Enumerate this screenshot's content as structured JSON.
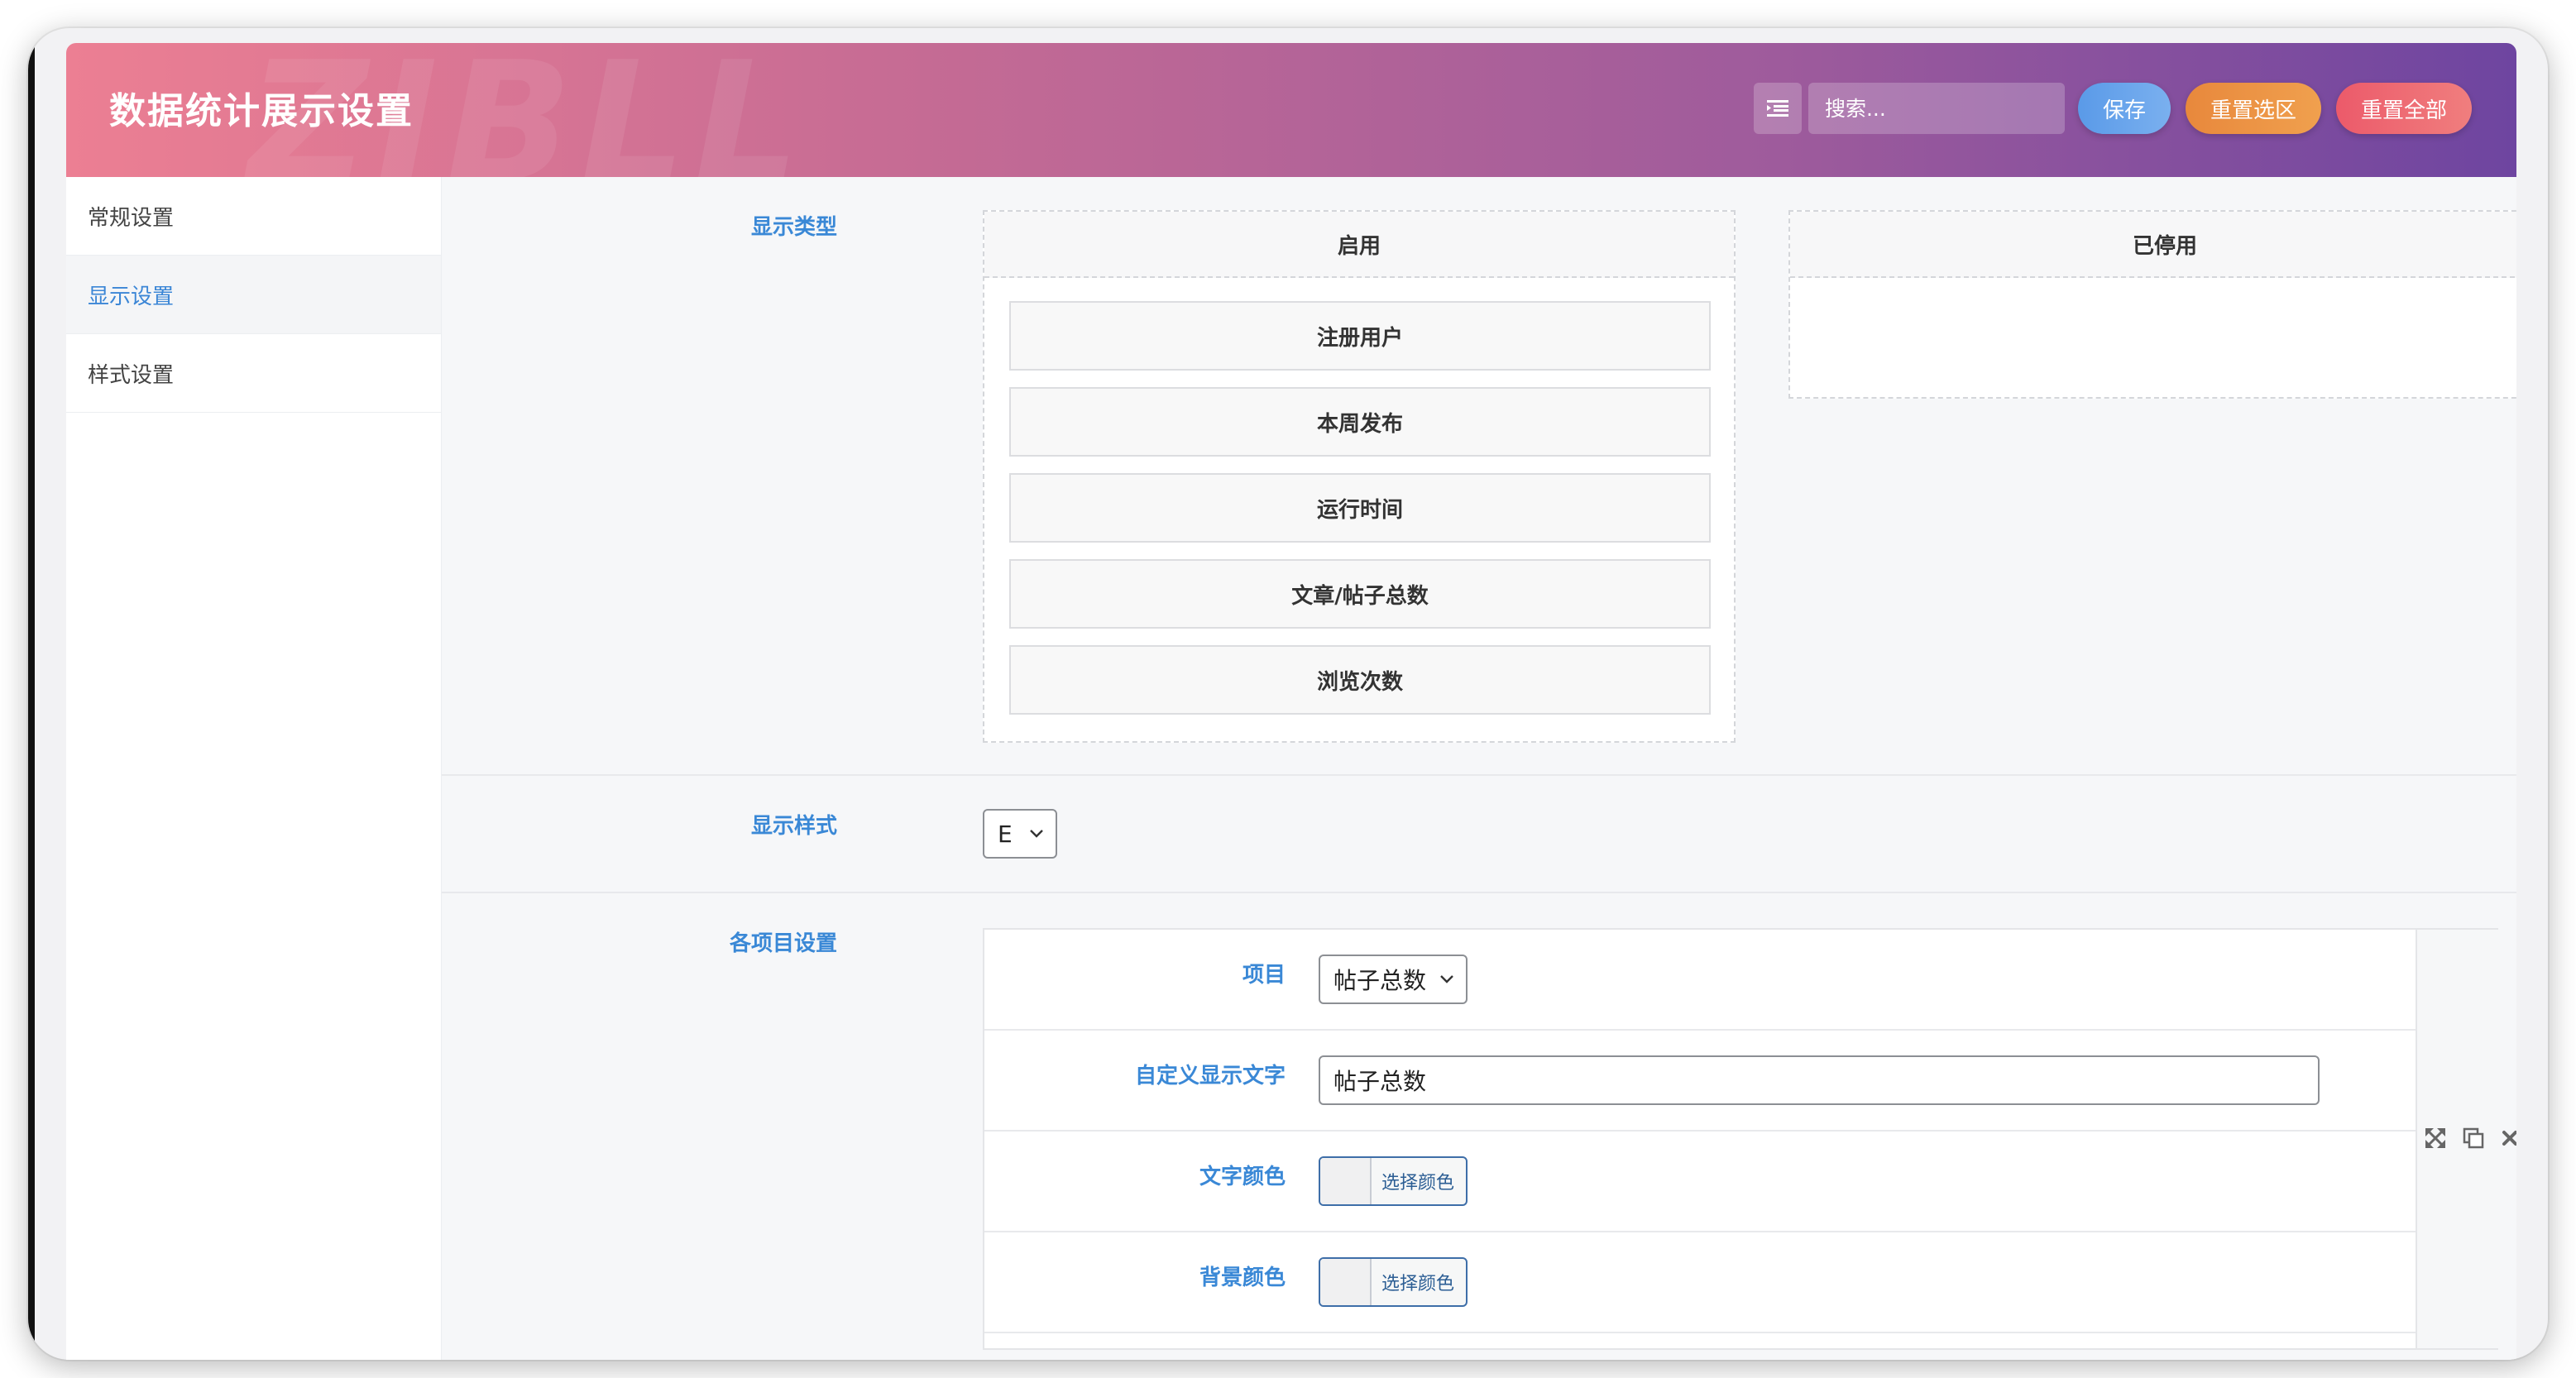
{
  "header": {
    "title": "数据统计展示设置",
    "watermark": "ZIBLL",
    "search_placeholder": "搜索...",
    "buttons": {
      "save": "保存",
      "reset_section": "重置选区",
      "reset_all": "重置全部"
    }
  },
  "sidebar": {
    "items": [
      {
        "label": "常规设置",
        "active": false
      },
      {
        "label": "显示设置",
        "active": true
      },
      {
        "label": "样式设置",
        "active": false
      }
    ]
  },
  "display_type": {
    "label": "显示类型",
    "enabled_title": "启用",
    "disabled_title": "已停用",
    "enabled_items": [
      "注册用户",
      "本周发布",
      "运行时间",
      "文章/帖子总数",
      "浏览次数"
    ],
    "disabled_items": []
  },
  "display_style": {
    "label": "显示样式",
    "value": "E"
  },
  "item_settings": {
    "label": "各项目设置",
    "fields": {
      "item_label": "项目",
      "item_value": "帖子总数",
      "custom_text_label": "自定义显示文字",
      "custom_text_value": "帖子总数",
      "text_color_label": "文字颜色",
      "bg_color_label": "背景颜色",
      "pick_color": "选择颜色"
    }
  },
  "colors": {
    "accent": "#3a88d6",
    "header_start": "#ec7f93",
    "header_end": "#6e45a0",
    "save": "#5a9ae8",
    "reset_section": "#e8883c",
    "reset_all": "#ec5a6a"
  }
}
